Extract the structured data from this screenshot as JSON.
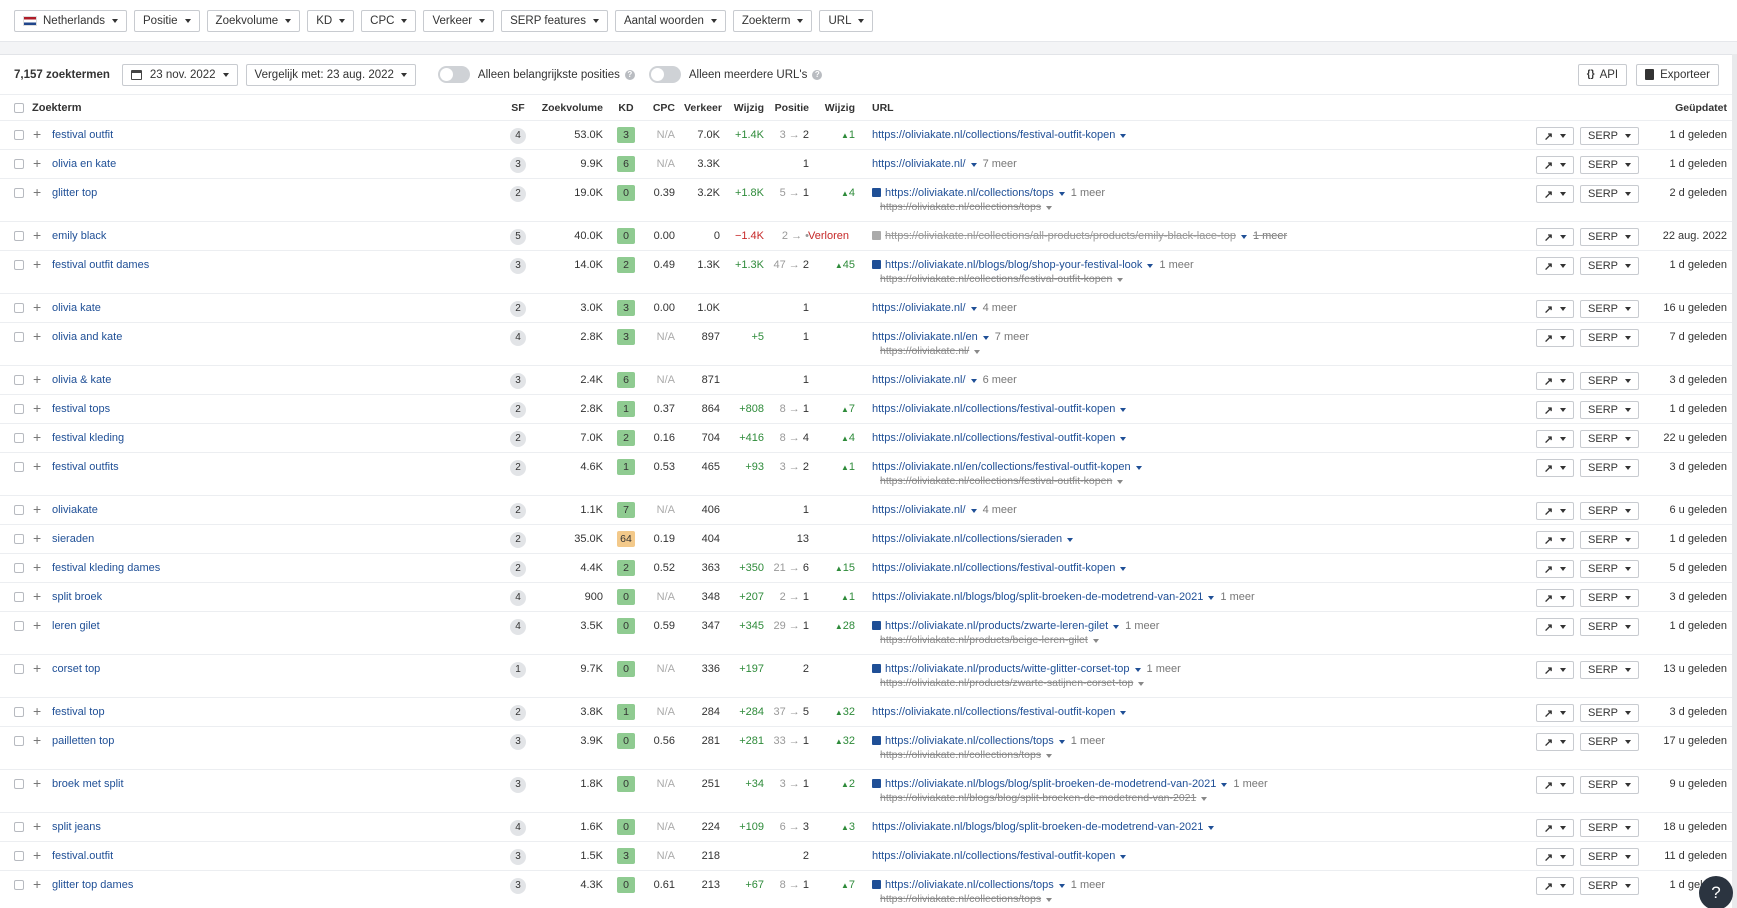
{
  "filters": {
    "country": "Netherlands",
    "items": [
      "Positie",
      "Zoekvolume",
      "KD",
      "CPC",
      "Verkeer",
      "SERP features",
      "Aantal woorden",
      "Zoekterm",
      "URL"
    ]
  },
  "toolbar": {
    "count": "7,157 zoektermen",
    "date": "23 nov. 2022",
    "compare": "Vergelijk met: 23 aug. 2022",
    "toggle1": "Alleen belangrijkste posities",
    "toggle2": "Alleen meerdere URL's",
    "api": "API",
    "export": "Exporteer"
  },
  "columns": {
    "keyword": "Zoekterm",
    "sf": "SF",
    "volume": "Zoekvolume",
    "kd": "KD",
    "cpc": "CPC",
    "traffic": "Verkeer",
    "traffic_change": "Wijzig",
    "position": "Positie",
    "position_change": "Wijzig",
    "url": "URL",
    "updated": "Geüpdatet"
  },
  "serp_label": "SERP",
  "colors": {
    "link": "#1f4f96",
    "green": "#2e8b3a",
    "red": "#c62828",
    "kd_easy": "#8fcb91",
    "kd_med": "#f3c98a"
  },
  "rows": [
    {
      "kw": "festival outfit",
      "sf": "4",
      "vol": "53.0K",
      "kd": "3",
      "cpc": "N/A",
      "traf": "7.0K",
      "wz": "+1.4K",
      "p_from": "3",
      "p_to": "2",
      "pchg": "1",
      "url": "https://oliviakate.nl/collections/festival-outfit-kopen",
      "url_caret": true,
      "upd": "1 d geleden"
    },
    {
      "kw": "olivia en kate",
      "sf": "3",
      "vol": "9.9K",
      "kd": "6",
      "cpc": "N/A",
      "traf": "3.3K",
      "wz": "",
      "p_from": "",
      "p_to": "1",
      "pchg": "",
      "url": "https://oliviakate.nl/",
      "url_caret": true,
      "more": "7 meer",
      "upd": "1 d geleden"
    },
    {
      "kw": "glitter top",
      "sf": "2",
      "vol": "19.0K",
      "kd": "0",
      "cpc": "0.39",
      "traf": "3.2K",
      "wz": "+1.8K",
      "p_from": "5",
      "p_to": "1",
      "pchg": "4",
      "url": "https://oliviakate.nl/collections/tops",
      "url_caret": true,
      "icon": true,
      "more": "1 meer",
      "url2": "https://oliviakate.nl/collections/tops",
      "upd": "2 d geleden"
    },
    {
      "kw": "emily black",
      "sf": "5",
      "vol": "40.0K",
      "kd": "0",
      "cpc": "0.00",
      "traf": "0",
      "wz": "−1.4K",
      "wz_red": true,
      "p_from": "2",
      "p_to": "•",
      "lost": "Verloren",
      "pchg": "",
      "url": "https://oliviakate.nl/collections/all-products/products/emily-black-lace-top",
      "url_lost": true,
      "url_caret": true,
      "icon": true,
      "icon_gray": true,
      "more": "1 meer",
      "upd": "22 aug. 2022"
    },
    {
      "kw": "festival outfit dames",
      "sf": "3",
      "vol": "14.0K",
      "kd": "2",
      "cpc": "0.49",
      "traf": "1.3K",
      "wz": "+1.3K",
      "p_from": "47",
      "p_to": "2",
      "pchg": "45",
      "url": "https://oliviakate.nl/blogs/blog/shop-your-festival-look",
      "url_caret": true,
      "icon": true,
      "more": "1 meer",
      "url2": "https://oliviakate.nl/collections/festival-outfit-kopen",
      "upd": "1 d geleden"
    },
    {
      "kw": "olivia kate",
      "sf": "2",
      "vol": "3.0K",
      "kd": "3",
      "cpc": "0.00",
      "traf": "1.0K",
      "wz": "",
      "p_from": "",
      "p_to": "1",
      "pchg": "",
      "url": "https://oliviakate.nl/",
      "url_caret": true,
      "more": "4 meer",
      "upd": "16 u geleden"
    },
    {
      "kw": "olivia and kate",
      "sf": "4",
      "vol": "2.8K",
      "kd": "3",
      "cpc": "N/A",
      "traf": "897",
      "wz": "+5",
      "p_from": "",
      "p_to": "1",
      "pchg": "",
      "url": "https://oliviakate.nl/en",
      "url_caret": true,
      "more": "7 meer",
      "url2": "https://oliviakate.nl/",
      "upd": "7 d geleden"
    },
    {
      "kw": "olivia & kate",
      "sf": "3",
      "vol": "2.4K",
      "kd": "6",
      "cpc": "N/A",
      "traf": "871",
      "wz": "",
      "p_from": "",
      "p_to": "1",
      "pchg": "",
      "url": "https://oliviakate.nl/",
      "url_caret": true,
      "more": "6 meer",
      "upd": "3 d geleden"
    },
    {
      "kw": "festival tops",
      "sf": "2",
      "vol": "2.8K",
      "kd": "1",
      "cpc": "0.37",
      "traf": "864",
      "wz": "+808",
      "p_from": "8",
      "p_to": "1",
      "pchg": "7",
      "url": "https://oliviakate.nl/collections/festival-outfit-kopen",
      "url_caret": true,
      "upd": "1 d geleden"
    },
    {
      "kw": "festival kleding",
      "sf": "2",
      "vol": "7.0K",
      "kd": "2",
      "cpc": "0.16",
      "traf": "704",
      "wz": "+416",
      "p_from": "8",
      "p_to": "4",
      "pchg": "4",
      "url": "https://oliviakate.nl/collections/festival-outfit-kopen",
      "url_caret": true,
      "upd": "22 u geleden"
    },
    {
      "kw": "festival outfits",
      "sf": "2",
      "vol": "4.6K",
      "kd": "1",
      "cpc": "0.53",
      "traf": "465",
      "wz": "+93",
      "p_from": "3",
      "p_to": "2",
      "pchg": "1",
      "url": "https://oliviakate.nl/en/collections/festival-outfit-kopen",
      "url_caret": true,
      "url2": "https://oliviakate.nl/collections/festival-outfit-kopen",
      "upd": "3 d geleden"
    },
    {
      "kw": "oliviakate",
      "sf": "2",
      "vol": "1.1K",
      "kd": "7",
      "cpc": "N/A",
      "traf": "406",
      "wz": "",
      "p_from": "",
      "p_to": "1",
      "pchg": "",
      "url": "https://oliviakate.nl/",
      "url_caret": true,
      "more": "4 meer",
      "upd": "6 u geleden"
    },
    {
      "kw": "sieraden",
      "sf": "2",
      "vol": "35.0K",
      "kd": "64",
      "kd_med": true,
      "cpc": "0.19",
      "traf": "404",
      "wz": "",
      "p_from": "",
      "p_to": "13",
      "pchg": "",
      "url": "https://oliviakate.nl/collections/sieraden",
      "url_caret": true,
      "upd": "1 d geleden"
    },
    {
      "kw": "festival kleding dames",
      "sf": "2",
      "vol": "4.4K",
      "kd": "2",
      "cpc": "0.52",
      "traf": "363",
      "wz": "+350",
      "p_from": "21",
      "p_to": "6",
      "pchg": "15",
      "url": "https://oliviakate.nl/collections/festival-outfit-kopen",
      "url_caret": true,
      "upd": "5 d geleden"
    },
    {
      "kw": "split broek",
      "sf": "4",
      "vol": "900",
      "kd": "0",
      "cpc": "N/A",
      "traf": "348",
      "wz": "+207",
      "p_from": "2",
      "p_to": "1",
      "pchg": "1",
      "url": "https://oliviakate.nl/blogs/blog/split-broeken-de-modetrend-van-2021",
      "url_caret": true,
      "more": "1 meer",
      "upd": "3 d geleden"
    },
    {
      "kw": "leren gilet",
      "sf": "4",
      "vol": "3.5K",
      "kd": "0",
      "cpc": "0.59",
      "traf": "347",
      "wz": "+345",
      "p_from": "29",
      "p_to": "1",
      "pchg": "28",
      "url": "https://oliviakate.nl/products/zwarte-leren-gilet",
      "url_caret": true,
      "icon": true,
      "more": "1 meer",
      "url2": "https://oliviakate.nl/products/beige-leren-gilet",
      "upd": "1 d geleden"
    },
    {
      "kw": "corset top",
      "sf": "1",
      "vol": "9.7K",
      "kd": "0",
      "cpc": "N/A",
      "traf": "336",
      "wz": "+197",
      "p_from": "",
      "p_to": "2",
      "pchg": "",
      "url": "https://oliviakate.nl/products/witte-glitter-corset-top",
      "url_caret": true,
      "icon": true,
      "more": "1 meer",
      "url2": "https://oliviakate.nl/products/zwarte-satijnen-corset-top",
      "upd": "13 u geleden"
    },
    {
      "kw": "festival top",
      "sf": "2",
      "vol": "3.8K",
      "kd": "1",
      "cpc": "N/A",
      "traf": "284",
      "wz": "+284",
      "p_from": "37",
      "p_to": "5",
      "pchg": "32",
      "url": "https://oliviakate.nl/collections/festival-outfit-kopen",
      "url_caret": true,
      "upd": "3 d geleden"
    },
    {
      "kw": "pailletten top",
      "sf": "3",
      "vol": "3.9K",
      "kd": "0",
      "cpc": "0.56",
      "traf": "281",
      "wz": "+281",
      "p_from": "33",
      "p_to": "1",
      "pchg": "32",
      "url": "https://oliviakate.nl/collections/tops",
      "url_caret": true,
      "icon": true,
      "more": "1 meer",
      "url2": "https://oliviakate.nl/collections/tops",
      "upd": "17 u geleden"
    },
    {
      "kw": "broek met split",
      "sf": "3",
      "vol": "1.8K",
      "kd": "0",
      "cpc": "N/A",
      "traf": "251",
      "wz": "+34",
      "p_from": "3",
      "p_to": "1",
      "pchg": "2",
      "url": "https://oliviakate.nl/blogs/blog/split-broeken-de-modetrend-van-2021",
      "url_caret": true,
      "icon": true,
      "more": "1 meer",
      "url2": "https://oliviakate.nl/blogs/blog/split-broeken-de-modetrend-van-2021",
      "upd": "9 u geleden"
    },
    {
      "kw": "split jeans",
      "sf": "4",
      "vol": "1.6K",
      "kd": "0",
      "cpc": "N/A",
      "traf": "224",
      "wz": "+109",
      "p_from": "6",
      "p_to": "3",
      "pchg": "3",
      "url": "https://oliviakate.nl/blogs/blog/split-broeken-de-modetrend-van-2021",
      "url_caret": true,
      "upd": "18 u geleden"
    },
    {
      "kw": "festival.outfit",
      "sf": "3",
      "vol": "1.5K",
      "kd": "3",
      "cpc": "N/A",
      "traf": "218",
      "wz": "",
      "p_from": "",
      "p_to": "2",
      "pchg": "",
      "url": "https://oliviakate.nl/collections/festival-outfit-kopen",
      "url_caret": true,
      "upd": "11 d geleden"
    },
    {
      "kw": "glitter top dames",
      "sf": "3",
      "vol": "4.3K",
      "kd": "0",
      "cpc": "0.61",
      "traf": "213",
      "wz": "+67",
      "p_from": "8",
      "p_to": "1",
      "pchg": "7",
      "url": "https://oliviakate.nl/collections/tops",
      "url_caret": true,
      "icon": true,
      "more": "1 meer",
      "url2": "https://oliviakate.nl/collections/tops",
      "upd": "1 d geleden"
    }
  ],
  "help_label": "?"
}
